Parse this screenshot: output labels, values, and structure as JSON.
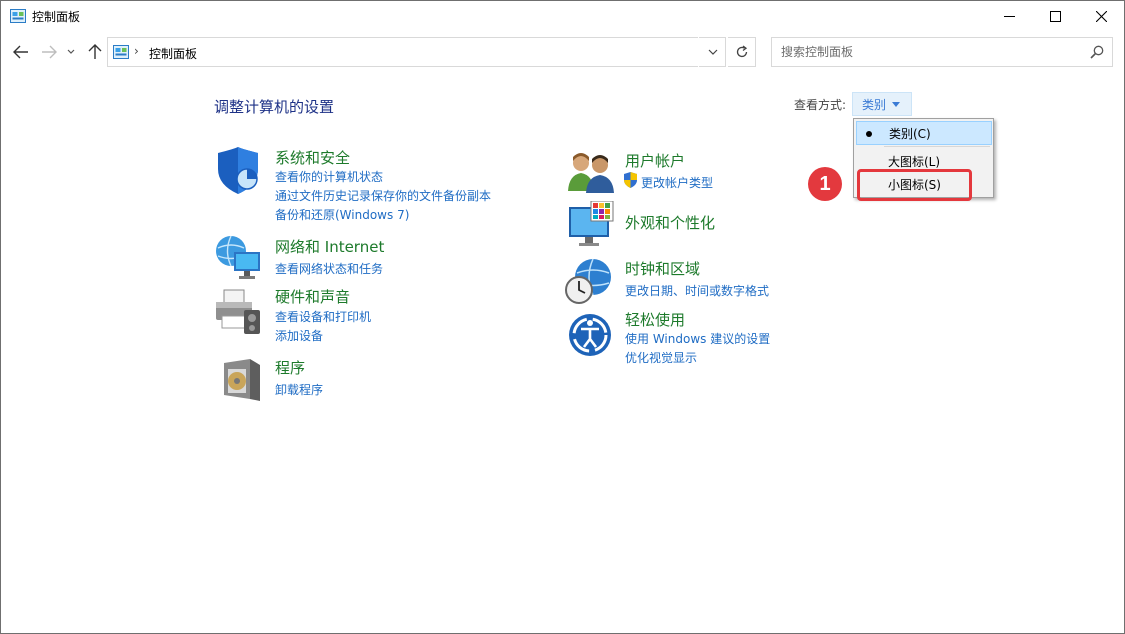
{
  "window": {
    "title": "控制面板"
  },
  "address": {
    "breadcrumb": "控制面板",
    "separator": "›"
  },
  "search": {
    "placeholder": "搜索控制面板"
  },
  "heading": "调整计算机的设置",
  "view": {
    "label": "查看方式:",
    "current": "类别",
    "menu": [
      "类别(C)",
      "大图标(L)",
      "小图标(S)"
    ]
  },
  "annotation": {
    "step": "1"
  },
  "categories": {
    "system": {
      "title": "系统和安全",
      "links": [
        "查看你的计算机状态",
        "通过文件历史记录保存你的文件备份副本",
        "备份和还原(Windows 7)"
      ]
    },
    "network": {
      "title": "网络和 Internet",
      "links": [
        "查看网络状态和任务"
      ]
    },
    "hardware": {
      "title": "硬件和声音",
      "links": [
        "查看设备和打印机",
        "添加设备"
      ]
    },
    "programs": {
      "title": "程序",
      "links": [
        "卸载程序"
      ]
    },
    "users": {
      "title": "用户帐户",
      "links": [
        "更改帐户类型"
      ]
    },
    "appearance": {
      "title": "外观和个性化",
      "links": []
    },
    "clock": {
      "title": "时钟和区域",
      "links": [
        "更改日期、时间或数字格式"
      ]
    },
    "ease": {
      "title": "轻松使用",
      "links": [
        "使用 Windows 建议的设置",
        "优化视觉显示"
      ]
    }
  },
  "colors": {
    "accent": "#1f6cc4",
    "category_title": "#1d7a2b",
    "heading": "#1e3287",
    "annotation": "#e3393e"
  }
}
